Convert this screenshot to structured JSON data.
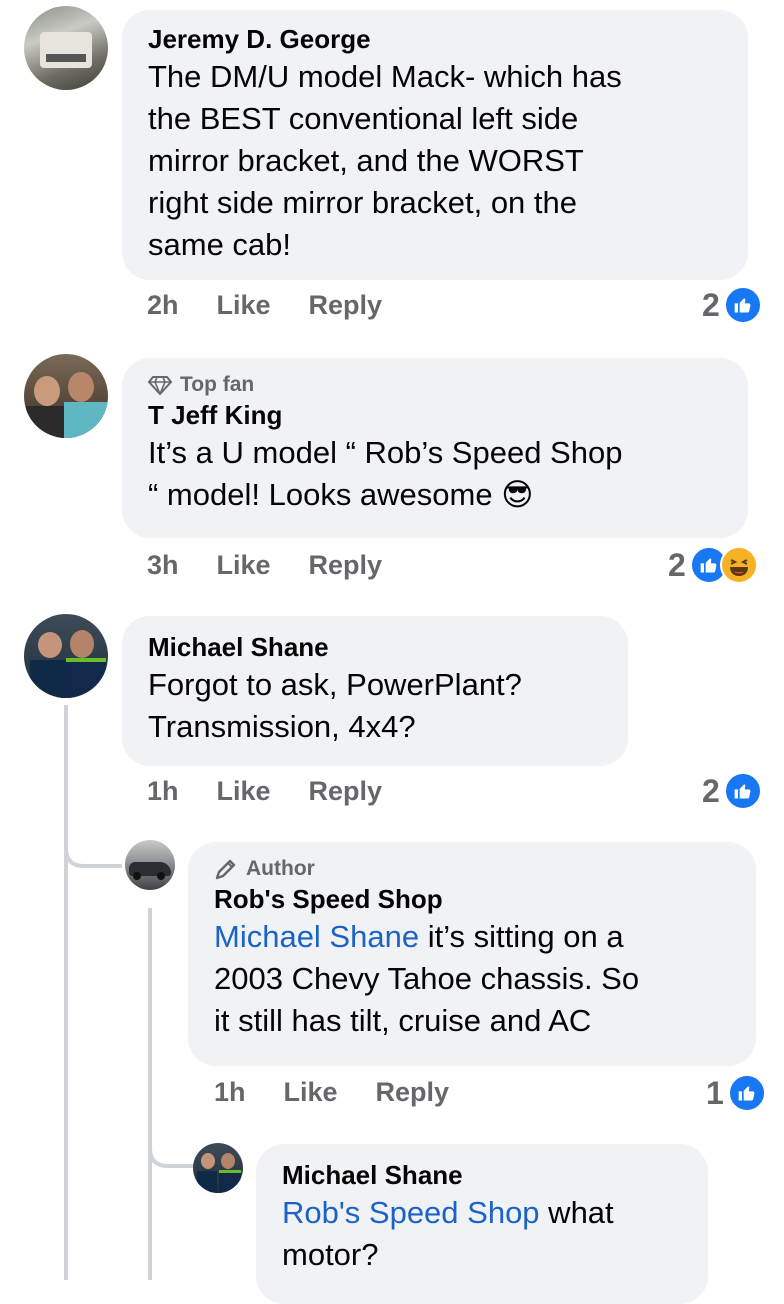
{
  "comments": [
    {
      "author": "Jeremy D. George",
      "text_lines": [
        "The DM/U model Mack- which has",
        "the BEST conventional left side",
        "mirror bracket, and the WORST",
        "right side mirror bracket, on the",
        "same cab!"
      ],
      "time": "2h",
      "like_label": "Like",
      "reply_label": "Reply",
      "reaction_count": "2",
      "reaction_icons": [
        "like-icon"
      ]
    },
    {
      "badge_icon": "diamond-icon",
      "badge": "Top fan",
      "author": "T Jeff King",
      "text_lines": [
        "It’s a U model “ Rob’s Speed Shop",
        "“ model! Looks awesome"
      ],
      "emoji": "😎",
      "time": "3h",
      "like_label": "Like",
      "reply_label": "Reply",
      "reaction_count": "2",
      "reaction_icons": [
        "like-icon",
        "haha-icon"
      ]
    },
    {
      "author": "Michael Shane",
      "text_lines": [
        "Forgot to ask, PowerPlant?",
        "Transmission, 4x4?"
      ],
      "time": "1h",
      "like_label": "Like",
      "reply_label": "Reply",
      "reaction_count": "2",
      "reaction_icons": [
        "like-icon"
      ]
    },
    {
      "badge_icon": "pencil-icon",
      "badge": "Author",
      "author": "Rob's Speed Shop",
      "mention": "Michael Shane",
      "text_lines": [
        " it’s sitting on a",
        "2003 Chevy Tahoe chassis. So",
        "it still has tilt, cruise and AC"
      ],
      "time": "1h",
      "like_label": "Like",
      "reply_label": "Reply",
      "reaction_count": "1",
      "reaction_icons": [
        "like-icon"
      ]
    },
    {
      "author": "Michael Shane",
      "mention": "Rob's Speed Shop",
      "text_lines": [
        " what",
        "motor?"
      ]
    }
  ],
  "colors": {
    "bubble": "#f0f2f5",
    "mention": "#1b63c7",
    "meta": "#65676b",
    "like": "#1877f2"
  }
}
